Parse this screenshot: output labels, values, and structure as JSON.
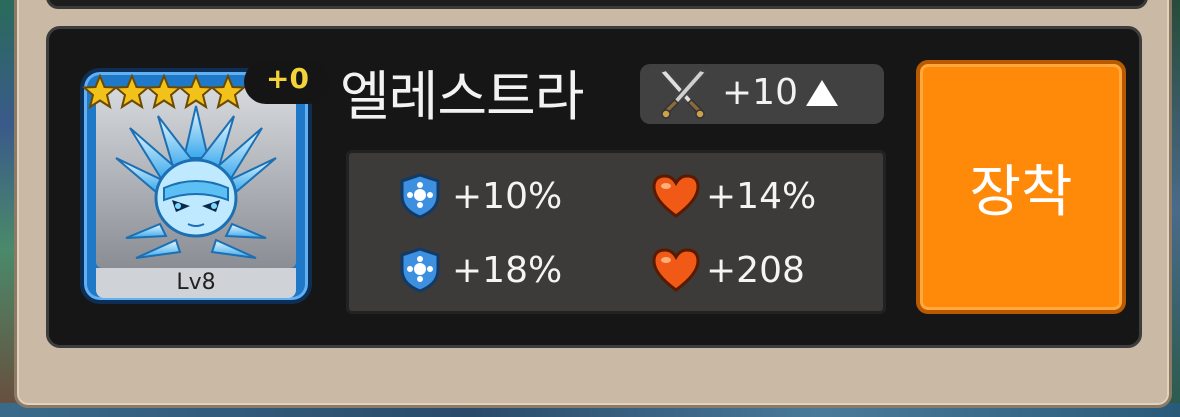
{
  "hero": {
    "name": "엘레스트라",
    "level": "Lv8",
    "star_count": 5,
    "star_color": "#f3c21a",
    "plus_level": "+0",
    "frame_color": "#2078c8"
  },
  "weapon": {
    "icon": "crossed-swords-icon",
    "enhance": "+10",
    "arrow_icon": "up-triangle-icon"
  },
  "stats": [
    {
      "icon": "shield-icon",
      "value": "+10%"
    },
    {
      "icon": "heart-icon",
      "value": "+14%"
    },
    {
      "icon": "shield-icon",
      "value": "+18%"
    },
    {
      "icon": "heart-icon",
      "value": "+208"
    }
  ],
  "equip_button": {
    "label": "장착",
    "color": "#ff8a0a"
  }
}
